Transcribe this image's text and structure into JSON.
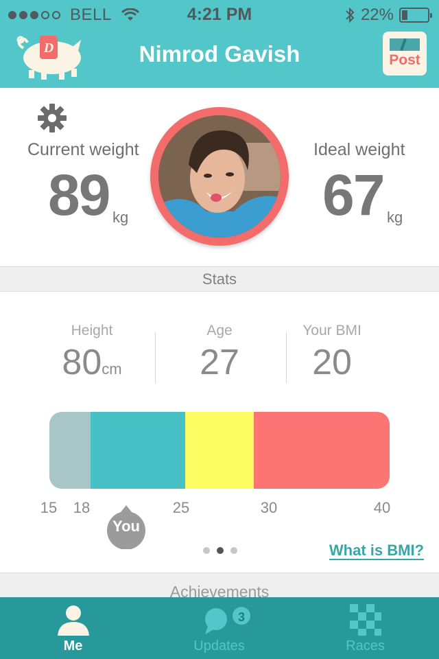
{
  "status_bar": {
    "carrier": "BELL",
    "time": "4:21 PM",
    "battery": "22%",
    "battery_level": 0.22,
    "signal_bars_filled": 3,
    "signal_bars_total": 5
  },
  "header": {
    "title": "Nimrod Gavish",
    "logo_letter": "D",
    "post_label": "Post"
  },
  "profile": {
    "current_weight_label": "Current weight",
    "current_weight_value": "89",
    "current_weight_unit": "kg",
    "ideal_weight_label": "Ideal weight",
    "ideal_weight_value": "67",
    "ideal_weight_unit": "kg"
  },
  "stats": {
    "section_title": "Stats",
    "height_label": "Height",
    "height_value": "80",
    "height_unit": "cm",
    "age_label": "Age",
    "age_value": "27",
    "bmi_label": "Your BMI",
    "bmi_value": "20"
  },
  "bmi_scale": {
    "ticks": [
      "15",
      "18",
      "25",
      "30",
      "40"
    ],
    "marker_label": "You",
    "marker_value": 20,
    "colors": {
      "underweight": "#a9c6c7",
      "normal": "#47c1c5",
      "overweight": "#fcfd62",
      "obese": "#fd7474"
    },
    "link": "What is BMI?",
    "pages_total": 3,
    "page_active": 2
  },
  "achievements": {
    "section_title": "Achievements"
  },
  "tabbar": {
    "tabs": [
      {
        "label": "Me",
        "active": true
      },
      {
        "label": "Updates",
        "active": false,
        "badge": "3"
      },
      {
        "label": "Races",
        "active": false
      }
    ]
  },
  "theme": {
    "teal": "#52c6c8",
    "dark_teal": "#27999a",
    "coral": "#f36c6c"
  }
}
